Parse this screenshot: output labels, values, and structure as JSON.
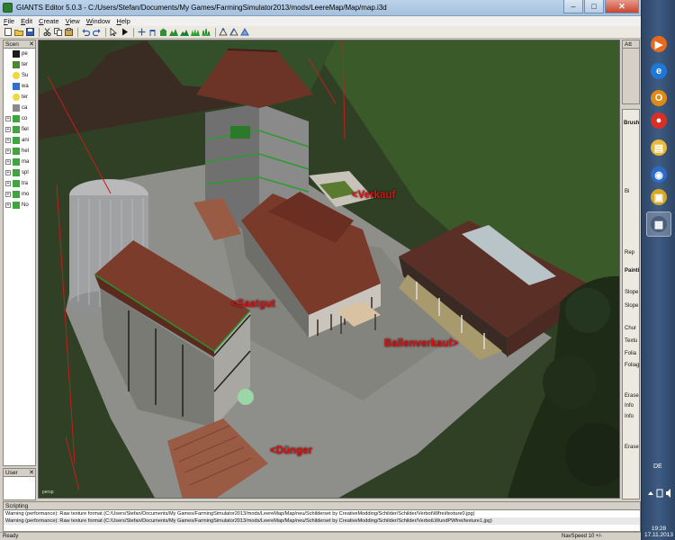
{
  "window": {
    "title": "GIANTS Editor 5.0.3 - C:/Users/Stefan/Documents/My Games/FarmingSimulator2013/mods/LeereMap/Map/map.i3d",
    "minimize": "–",
    "maximize": "□",
    "close": "✕"
  },
  "menu": [
    "File",
    "Edit",
    "Create",
    "View",
    "Window",
    "Help"
  ],
  "toolbar": {
    "icons": [
      "new-icon",
      "open-icon",
      "save-icon",
      "cut-icon",
      "copy-icon",
      "paste-icon",
      "undo-icon",
      "redo-icon",
      "cursor-icon",
      "play-icon",
      "move-icon",
      "rotate-icon",
      "scale-icon",
      "terrain-sculpt-icon",
      "terrain-paint-icon",
      "foliage-icon",
      "grass-icon",
      "vertex-icon",
      "edge-icon",
      "face-icon"
    ]
  },
  "scenegraph": {
    "title": "Scen",
    "items": [
      {
        "label": "pe",
        "icon": "camera-icon",
        "color": "#1b1b1b",
        "expander": ""
      },
      {
        "label": "ter",
        "icon": "terrain-icon",
        "color": "#4a8a2a",
        "expander": ""
      },
      {
        "label": "Su",
        "icon": "light-icon",
        "color": "#f2d93a",
        "expander": ""
      },
      {
        "label": "wa",
        "icon": "water-icon",
        "color": "#2e6fd0",
        "expander": ""
      },
      {
        "label": "ter",
        "icon": "light-icon",
        "color": "#f2d93a",
        "expander": ""
      },
      {
        "label": "ca",
        "icon": "shape-icon",
        "color": "#8a8a8a",
        "expander": ""
      },
      {
        "label": "co",
        "icon": "transform-group-icon",
        "color": "#3fa53f",
        "expander": "+"
      },
      {
        "label": "fiel",
        "icon": "transform-group-icon",
        "color": "#3fa53f",
        "expander": "+"
      },
      {
        "label": "ani",
        "icon": "transform-group-icon",
        "color": "#3fa53f",
        "expander": "+"
      },
      {
        "label": "hel",
        "icon": "transform-group-icon",
        "color": "#3fa53f",
        "expander": "+"
      },
      {
        "label": "ma",
        "icon": "transform-group-icon",
        "color": "#3fa53f",
        "expander": "+"
      },
      {
        "label": "spl",
        "icon": "transform-group-icon",
        "color": "#3fa53f",
        "expander": "+"
      },
      {
        "label": "tra",
        "icon": "transform-group-icon",
        "color": "#3fa53f",
        "expander": "+"
      },
      {
        "label": "mo",
        "icon": "transform-group-icon",
        "color": "#3fa53f",
        "expander": "+"
      },
      {
        "label": "No",
        "icon": "transform-group-icon",
        "color": "#3fa53f",
        "expander": "+"
      }
    ]
  },
  "user_attributes": {
    "title": "User"
  },
  "attributes": {
    "title": "Att"
  },
  "tools": {
    "title": "Brush",
    "labels": [
      {
        "text": "Bi",
        "bold": false
      },
      {
        "text": "Rep",
        "bold": false
      },
      {
        "text": "Paintin",
        "bold": true
      },
      {
        "text": "Slope L",
        "bold": false
      },
      {
        "text": "Slope",
        "bold": false
      },
      {
        "text": "Chur",
        "bold": false
      },
      {
        "text": "Textu",
        "bold": false
      },
      {
        "text": "Folia",
        "bold": false
      },
      {
        "text": "Foliage",
        "bold": false
      },
      {
        "text": "Erase U",
        "bold": false
      },
      {
        "text": "Info",
        "bold": false
      },
      {
        "text": "Info",
        "bold": false
      },
      {
        "text": "Erase U",
        "bold": false
      }
    ]
  },
  "viewport": {
    "labels": {
      "verkauf": "<Verkauf",
      "saatgut": "<Saatgut",
      "ballen": "Ballenverkauf>",
      "duenger": "<Dünger"
    },
    "camera": "persp"
  },
  "scripting": {
    "title": "Scripting",
    "lines": [
      "Warning (performance): Raw texture format (C:/Users/Stefan/Documents/My Games/FarmingSimulator2013/mods/LeereMap/Map/neu/Schilderset by CreativeModding/Schilder/Schilder/Verbot\\Wfrei/texture0.jpg)",
      "Warning (performance): Raw texture format (C:/Users/Stefan/Documents/My Games/FarmingSimulator2013/mods/LeereMap/Map/neu/Schilderset by CreativeModding/Schilder/Schilder/VerbotLWundPWfrei/texture1.jpg)"
    ]
  },
  "status": {
    "ready": "Ready",
    "navspeed": "NavSpeed 10 +/-"
  },
  "taskbar": {
    "apps": [
      {
        "name": "media-player-icon",
        "color": "#e66a1e",
        "glyph": "▶"
      },
      {
        "name": "internet-explorer-icon",
        "color": "#1e78d7",
        "glyph": "e"
      },
      {
        "name": "outlook-icon",
        "color": "#e08a16",
        "glyph": "O"
      },
      {
        "name": "chrome-icon",
        "color": "#d93025",
        "glyph": "●"
      },
      {
        "name": "explorer-icon",
        "color": "#e8b93a",
        "glyph": "▤"
      },
      {
        "name": "google-earth-icon",
        "color": "#2c6cc9",
        "glyph": "◉"
      },
      {
        "name": "archive-icon",
        "color": "#d6a82a",
        "glyph": "▣"
      },
      {
        "name": "giants-editor-icon",
        "color": "#4a5f7a",
        "glyph": "▦"
      }
    ],
    "language": "DE",
    "time": "19:28",
    "date": "17.11.2013"
  }
}
